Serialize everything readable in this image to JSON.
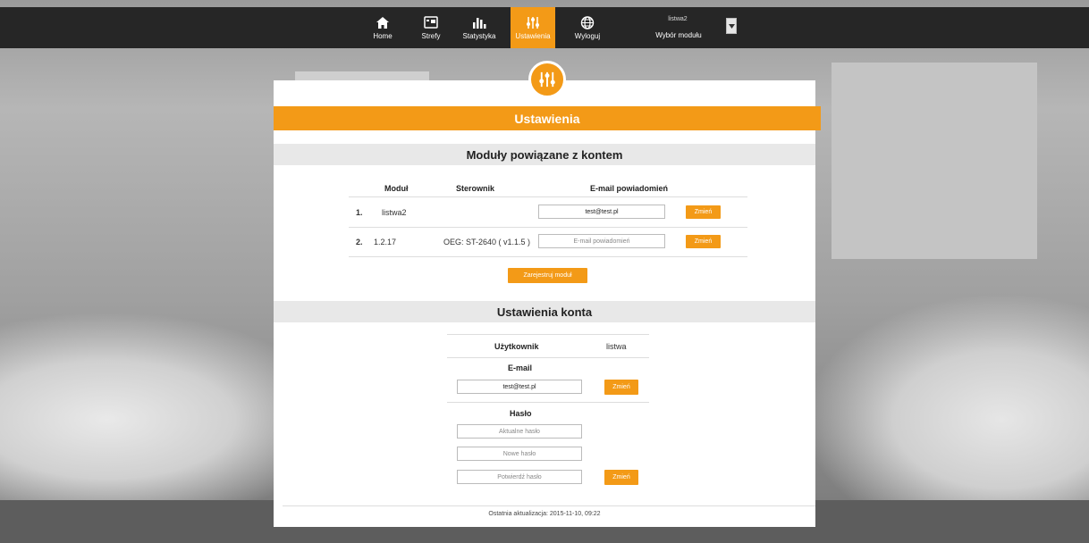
{
  "nav": {
    "items": [
      {
        "label": "Home",
        "icon": "home-icon"
      },
      {
        "label": "Strefy",
        "icon": "zones-icon"
      },
      {
        "label": "Statystyka",
        "icon": "chart-icon"
      },
      {
        "label": "Ustawienia",
        "icon": "sliders-icon"
      },
      {
        "label": "Wyloguj",
        "icon": "globe-icon"
      }
    ],
    "module_name": "listwa2",
    "module_select_label": "Wybór modułu"
  },
  "page": {
    "title": "Ustawienia"
  },
  "modules": {
    "section_title": "Moduły powiązane z kontem",
    "headers": {
      "module": "Moduł",
      "controller": "Sterownik",
      "email": "E-mail powiadomień"
    },
    "rows": [
      {
        "index": "1.",
        "module": "listwa2",
        "controller": "",
        "email_value": "test@test.pl",
        "email_placeholder": "",
        "button": "Zmień"
      },
      {
        "index": "2.",
        "module": "1.2.17",
        "controller": "OEG: ST-2640 ( v1.1.5 )",
        "email_value": "",
        "email_placeholder": "E-mail powiadomień",
        "button": "Zmień"
      }
    ],
    "register_button": "Zarejestruj moduł"
  },
  "account": {
    "section_title": "Ustawienia konta",
    "user_label": "Użytkownik",
    "user_value": "listwa",
    "email_label": "E-mail",
    "email_value": "test@test.pl",
    "email_button": "Zmień",
    "password_label": "Hasło",
    "current_password_placeholder": "Aktualne hasło",
    "new_password_placeholder": "Nowe hasło",
    "confirm_password_placeholder": "Potwierdź hasło",
    "password_button": "Zmień"
  },
  "footer": {
    "last_update": "Ostatnia aktualizacja: 2015-11-10, 09:22"
  },
  "colors": {
    "accent": "#f39a17",
    "topbar": "#262626",
    "section": "#e8e8e8"
  }
}
